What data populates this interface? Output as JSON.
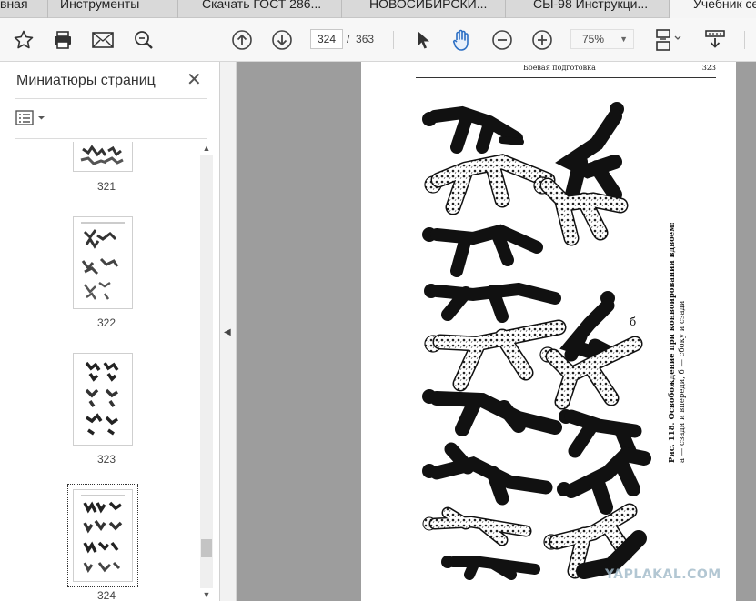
{
  "tabs": [
    {
      "label": "вная"
    },
    {
      "label": "Инструменты"
    },
    {
      "label": "Скачать ГОСТ 286..."
    },
    {
      "label": "НОВОСИБИРСКИ..."
    },
    {
      "label": "СЫ-98 Инструкци..."
    },
    {
      "label": "Учебник се"
    }
  ],
  "toolbar": {
    "current_page": "324",
    "page_separator": "/",
    "total_pages": "363",
    "zoom": "75%",
    "icons": [
      "star-icon",
      "print-icon",
      "mail-icon",
      "zoom-search-icon",
      "prev-page-icon",
      "next-page-icon",
      "select-cursor-icon",
      "hand-tool-icon",
      "zoom-out-icon",
      "zoom-in-icon",
      "page-fit-icon",
      "scroll-mode-icon"
    ]
  },
  "sidebar": {
    "title": "Миниатюры страниц",
    "close_symbol": "✕",
    "thumbnails": [
      {
        "label": "321"
      },
      {
        "label": "322"
      },
      {
        "label": "323"
      },
      {
        "label": "324",
        "selected": true
      }
    ]
  },
  "document": {
    "header_title": "Боевая подготовка",
    "page_number": "323",
    "figure_marker": "б",
    "caption_line1": "Рис. 118. Освобождение при конвоировании вдвоем:",
    "caption_line2": "а — сзади и впереди, б — сбоку и сзади"
  },
  "watermark": "YAPLAKAL.COM",
  "colors": {
    "accent_blue": "#2c6fc4",
    "toolbar_bg": "#f7f7f7",
    "doc_bg": "#9d9d9d"
  }
}
